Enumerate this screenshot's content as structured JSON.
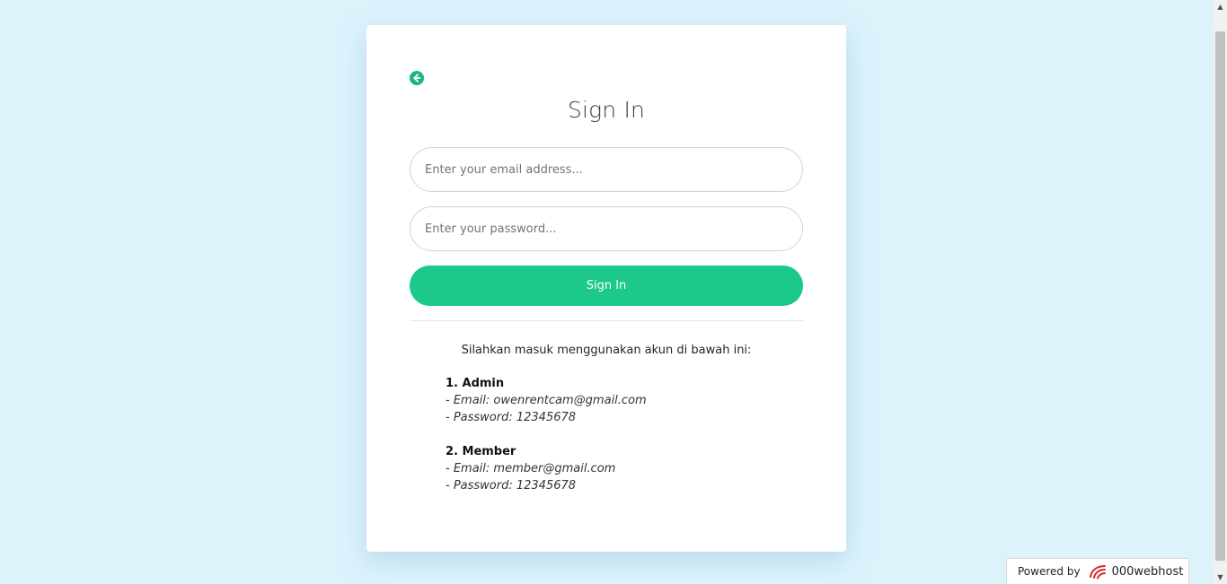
{
  "card": {
    "back_icon": "arrow-circle-left-icon",
    "title": "Sign In",
    "email_placeholder": "Enter your email address...",
    "password_placeholder": "Enter your password...",
    "submit_label": "Sign In",
    "intro": "Silahkan masuk menggunakan akun di bawah ini:",
    "accounts": [
      {
        "heading": "1. Admin",
        "email": "- Email: owenrentcam@gmail.com",
        "password": "- Password: 12345678"
      },
      {
        "heading": "2. Member",
        "email": "- Email: member@gmail.com",
        "password": "- Password: 12345678"
      }
    ]
  },
  "footer": {
    "powered_by": "Powered by",
    "brand": "000webhost"
  },
  "colors": {
    "background": "#dcf3fc",
    "accent": "#1dc98a",
    "card": "#ffffff"
  }
}
